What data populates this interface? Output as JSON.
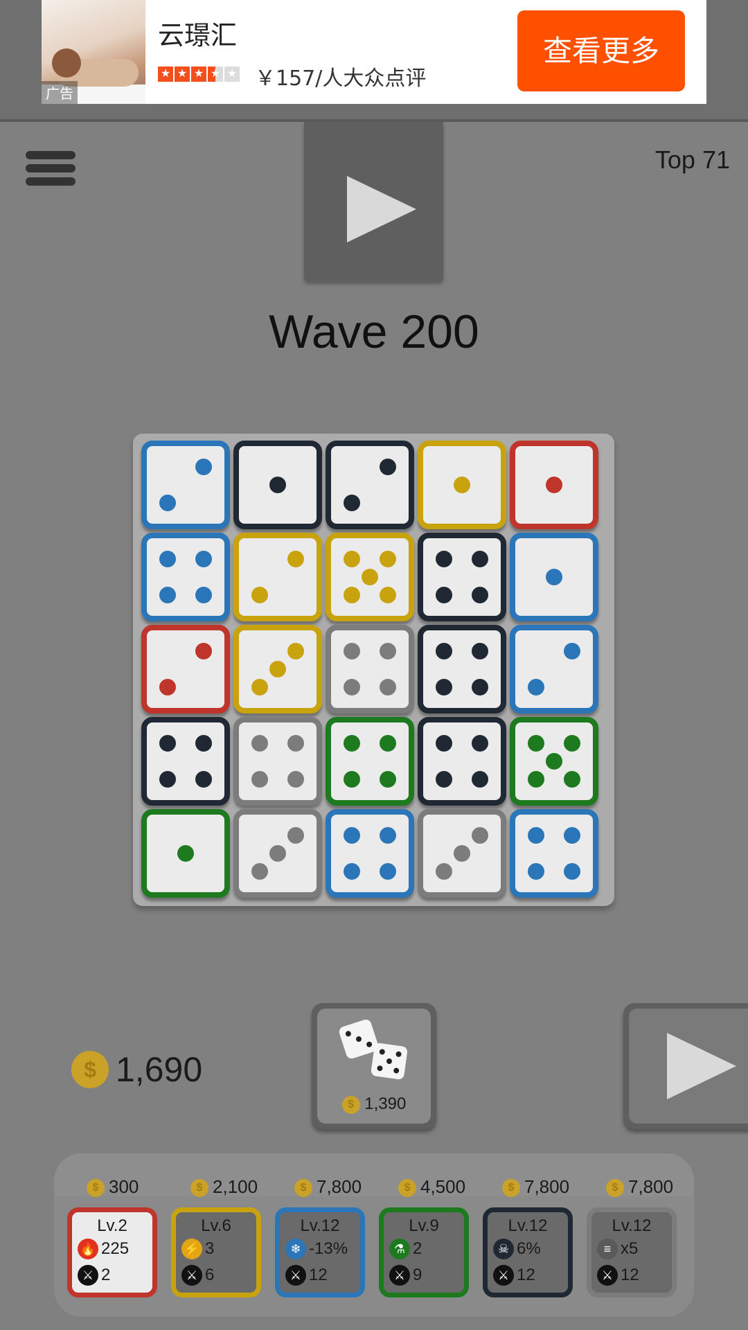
{
  "ad": {
    "tag": "广告",
    "title": "云璟汇",
    "rating_stars": 3.5,
    "price": "￥157/人大众点评",
    "cta": "查看更多"
  },
  "header": {
    "rank": "Top 71"
  },
  "game": {
    "wave": "Wave 200",
    "coins": "1,690",
    "roll_cost": "1,390"
  },
  "colors": {
    "blue": "#2a76b8",
    "black": "#1f2833",
    "yellow": "#c9a30e",
    "red": "#c0352b",
    "gray": "#7c7c7c",
    "green": "#1e7a1e"
  },
  "board": [
    [
      {
        "color": "blue",
        "pips": 2
      },
      {
        "color": "black",
        "pips": 1
      },
      {
        "color": "black",
        "pips": 2
      },
      {
        "color": "yellow",
        "pips": 1
      },
      {
        "color": "red",
        "pips": 1
      }
    ],
    [
      {
        "color": "blue",
        "pips": 4
      },
      {
        "color": "yellow",
        "pips": 2
      },
      {
        "color": "yellow",
        "pips": 5
      },
      {
        "color": "black",
        "pips": 4
      },
      {
        "color": "blue",
        "pips": 1
      }
    ],
    [
      {
        "color": "red",
        "pips": 2
      },
      {
        "color": "yellow",
        "pips": 3
      },
      {
        "color": "gray",
        "pips": 4
      },
      {
        "color": "black",
        "pips": 4
      },
      {
        "color": "blue",
        "pips": 2
      }
    ],
    [
      {
        "color": "black",
        "pips": 4
      },
      {
        "color": "gray",
        "pips": 4
      },
      {
        "color": "green",
        "pips": 4
      },
      {
        "color": "black",
        "pips": 4
      },
      {
        "color": "green",
        "pips": 5
      }
    ],
    [
      {
        "color": "green",
        "pips": 1
      },
      {
        "color": "gray",
        "pips": 3
      },
      {
        "color": "blue",
        "pips": 4
      },
      {
        "color": "gray",
        "pips": 3
      },
      {
        "color": "blue",
        "pips": 4
      }
    ]
  ],
  "upgrades": [
    {
      "cost": "300",
      "level": "Lv.2",
      "stat_icon": "fire-icon",
      "stat": "225",
      "damage": "2",
      "color": "red",
      "active": true
    },
    {
      "cost": "2,100",
      "level": "Lv.6",
      "stat_icon": "lightning-icon",
      "stat": "3",
      "damage": "6",
      "color": "yellow",
      "active": false
    },
    {
      "cost": "7,800",
      "level": "Lv.12",
      "stat_icon": "snowflake-icon",
      "stat": "-13%",
      "damage": "12",
      "color": "blue",
      "active": false
    },
    {
      "cost": "4,500",
      "level": "Lv.9",
      "stat_icon": "poison-flask-icon",
      "stat": "2",
      "damage": "9",
      "color": "green",
      "active": false
    },
    {
      "cost": "7,800",
      "level": "Lv.12",
      "stat_icon": "skull-icon",
      "stat": "6%",
      "damage": "12",
      "color": "black",
      "active": false
    },
    {
      "cost": "7,800",
      "level": "Lv.12",
      "stat_icon": "speed-bullet-icon",
      "stat": "x5",
      "damage": "12",
      "color": "gray",
      "active": false
    }
  ]
}
